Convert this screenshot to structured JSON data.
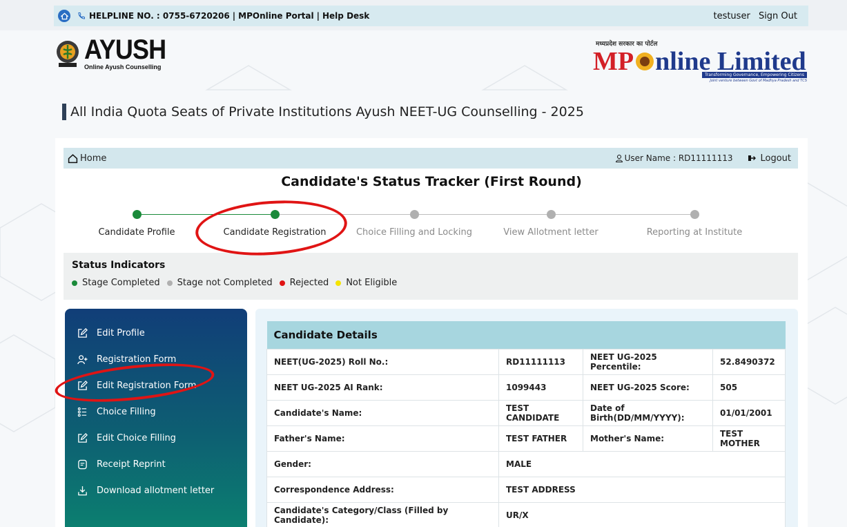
{
  "topbar": {
    "helpline": "HELPLINE NO. : 0755-6720206",
    "portal": "MPOnline Portal",
    "helpdesk": "Help Desk",
    "user": "testuser",
    "signout": "Sign Out"
  },
  "logos": {
    "ayush_title": "AYUSH",
    "ayush_subtitle": "Online Ayush Counselling",
    "mp_hindi": "मध्यप्रदेश सरकार का पोर्टल",
    "mp_red": "MP",
    "mp_blue": "nline Limited",
    "mp_tagline": "Transforming Governance, Empowering Citizens",
    "mp_tagline2": "Joint venture between Govt of Madhya Pradesh and TCS"
  },
  "page_title": "All India Quota Seats of Private Institutions Ayush NEET-UG Counselling - 2025",
  "home_bar": {
    "home": "Home",
    "user_label": "User Name : RD11111113",
    "logout": "Logout"
  },
  "tracker": {
    "title": "Candidate's Status Tracker (First Round)",
    "steps": [
      {
        "label": "Candidate Profile",
        "status": "completed"
      },
      {
        "label": "Candidate Registration",
        "status": "completed"
      },
      {
        "label": "Choice Filling and Locking",
        "status": "not_completed"
      },
      {
        "label": "View Allotment letter",
        "status": "not_completed"
      },
      {
        "label": "Reporting at Institute",
        "status": "not_completed"
      }
    ]
  },
  "status": {
    "title": "Status Indicators",
    "legend": [
      {
        "label": "Stage Completed",
        "color": "#1a8a3a"
      },
      {
        "label": "Stage not Completed",
        "color": "#b0b0b0"
      },
      {
        "label": "Rejected",
        "color": "#e01414"
      },
      {
        "label": "Not Eligible",
        "color": "#f5e400"
      }
    ]
  },
  "sidebar": {
    "items": [
      {
        "label": "Edit Profile",
        "icon": "edit-icon"
      },
      {
        "label": "Registration Form",
        "icon": "add-user-icon"
      },
      {
        "label": "Edit Registration Form",
        "icon": "edit-icon"
      },
      {
        "label": "Choice Filling",
        "icon": "list-icon"
      },
      {
        "label": "Edit Choice Filling",
        "icon": "edit-icon"
      },
      {
        "label": "Receipt Reprint",
        "icon": "receipt-icon"
      },
      {
        "label": "Download allotment letter",
        "icon": "download-icon"
      }
    ]
  },
  "details": {
    "title": "Candidate Details",
    "rows": [
      {
        "l1": "NEET(UG-2025) Roll No.:",
        "v1": "RD11111113",
        "l2": "NEET UG-2025 Percentile:",
        "v2": "52.8490372"
      },
      {
        "l1": "NEET UG-2025 AI Rank:",
        "v1": "1099443",
        "l2": "NEET UG-2025 Score:",
        "v2": "505"
      },
      {
        "l1": "Candidate's Name:",
        "v1": "TEST CANDIDATE",
        "l2": "Date of Birth(DD/MM/YYYY):",
        "v2": "01/01/2001"
      },
      {
        "l1": "Father's Name:",
        "v1": "TEST FATHER",
        "l2": "Mother's Name:",
        "v2": "TEST MOTHER"
      },
      {
        "l1": "Gender:",
        "v1": "MALE"
      },
      {
        "l1": "Correspondence Address:",
        "v1": "TEST ADDRESS"
      },
      {
        "l1": "Candidate's Category/Class (Filled by Candidate):",
        "v1": "UR/X"
      }
    ]
  },
  "colors": {
    "completed": "#1a8a3a",
    "not_completed": "#b0b0b0",
    "annotation": "#e01414"
  }
}
